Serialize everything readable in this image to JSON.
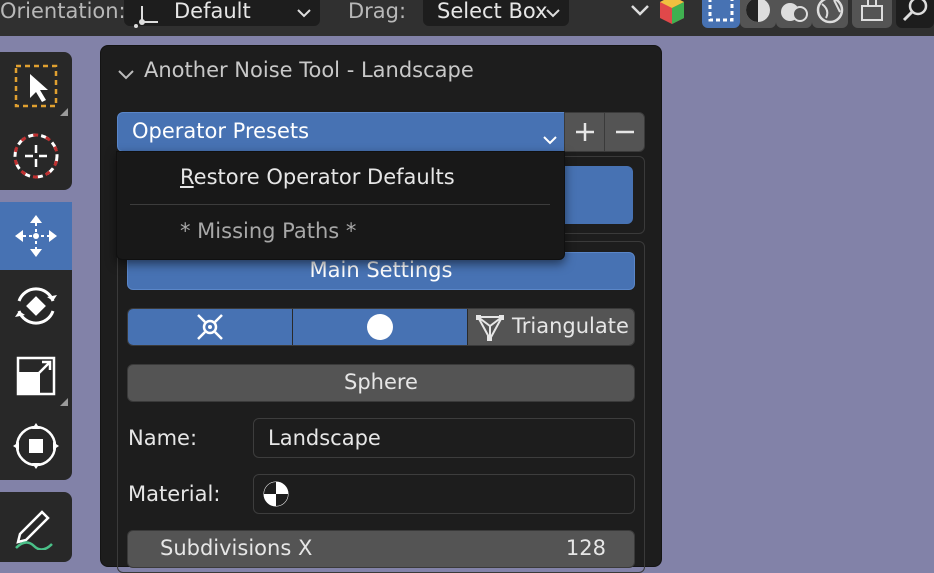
{
  "header": {
    "orientation_label": "Orientation:",
    "orientation_value": "Default",
    "drag_label": "Drag:",
    "drag_value": "Select Box"
  },
  "toolbar": {
    "tools": [
      "select-box-tool",
      "cursor-tool",
      "move-tool",
      "rotate-tool",
      "scale-tool",
      "transform-tool",
      "annotate-tool"
    ],
    "active_tool": "move-tool"
  },
  "panel": {
    "title": "Another Noise Tool - Landscape",
    "presets_label": "Operator Presets",
    "add_label": "+",
    "remove_label": "−",
    "main_settings_label": "Main Settings",
    "triangulate_label": "Triangulate",
    "sphere_label": "Sphere",
    "name_label": "Name:",
    "name_value": "Landscape",
    "material_label": "Material:",
    "subdivisions_label": "Subdivisions X",
    "subdivisions_value": "128"
  },
  "menu": {
    "items": [
      {
        "label": "Restore Operator Defaults",
        "mnemonic": "R",
        "rest": "estore Operator Defaults"
      },
      {
        "label": "* Missing Paths *"
      }
    ]
  },
  "colors": {
    "accent": "#4772b3",
    "background": "#8282a8",
    "panel": "#1d1d1d"
  }
}
